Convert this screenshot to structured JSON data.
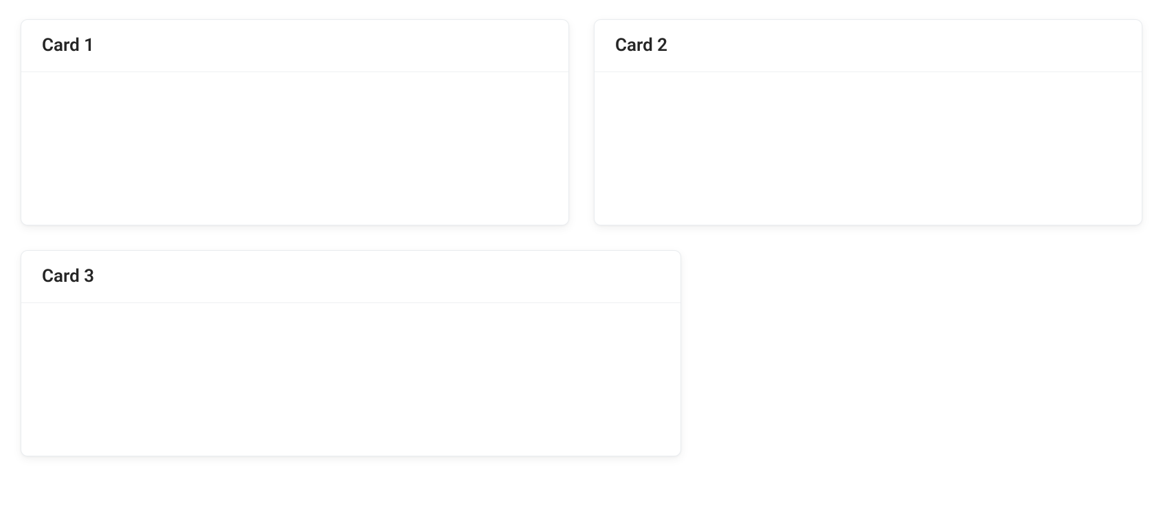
{
  "cards": [
    {
      "title": "Card 1"
    },
    {
      "title": "Card 2"
    },
    {
      "title": "Card 3"
    }
  ]
}
